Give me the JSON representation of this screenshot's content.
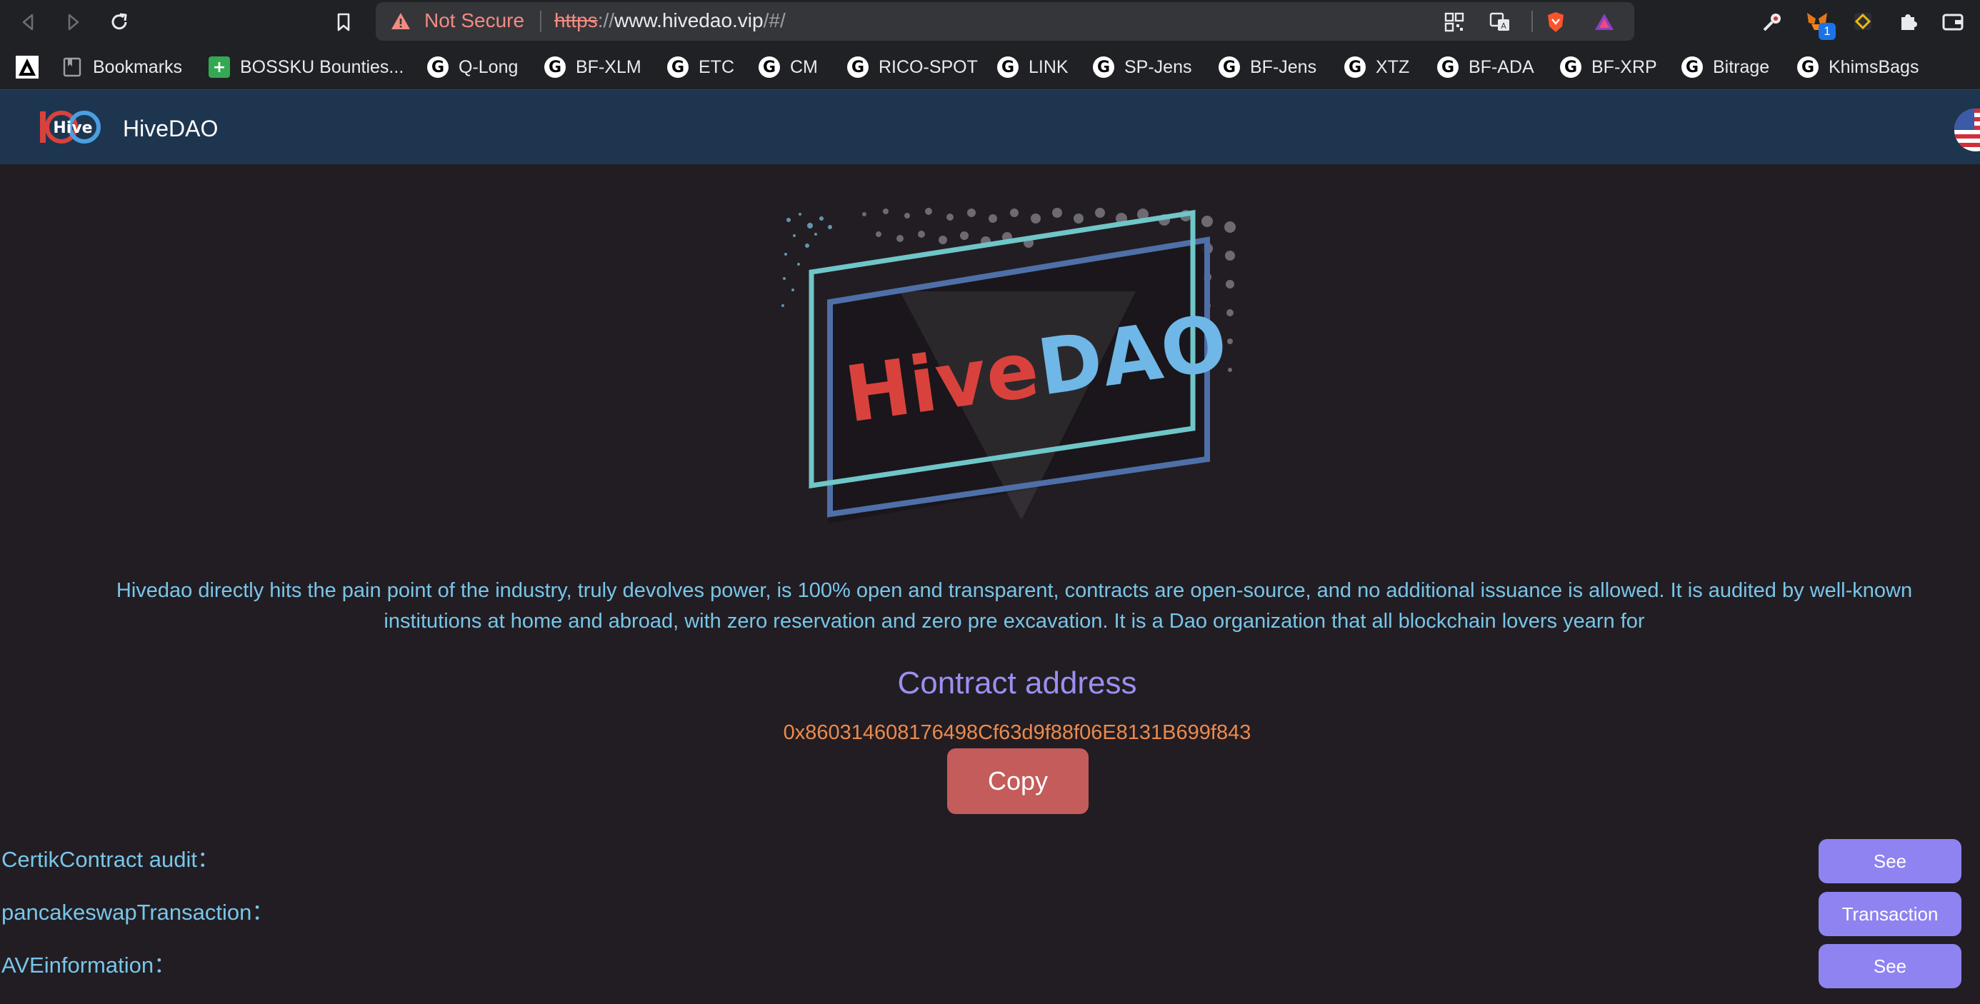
{
  "browser": {
    "security_label": "Not Secure",
    "url_scheme": "https",
    "url_sep": "://",
    "url_host": "www.hivedao.vip",
    "url_tail": "/#/",
    "extension_badge": "1"
  },
  "bookmarks": [
    {
      "label": "Bookmarks"
    },
    {
      "label": "BOSSKU Bounties..."
    },
    {
      "label": "Q-Long"
    },
    {
      "label": "BF-XLM"
    },
    {
      "label": "ETC"
    },
    {
      "label": "CM"
    },
    {
      "label": "RICO-SPOT"
    },
    {
      "label": "LINK"
    },
    {
      "label": "SP-Jens"
    },
    {
      "label": "BF-Jens"
    },
    {
      "label": "XTZ"
    },
    {
      "label": "BF-ADA"
    },
    {
      "label": "BF-XRP"
    },
    {
      "label": "Bitrage"
    },
    {
      "label": "KhimsBags"
    }
  ],
  "site": {
    "brand": "HiveDAO",
    "hero_text_part1": "Hive",
    "hero_text_part2": "DAO",
    "description": "Hivedao directly hits the pain point of the industry, truly devolves power, is 100% open and transparent, contracts are open-source, and no additional issuance is allowed. It is audited by well-known institutions at home and abroad, with zero reservation and zero pre excavation. It is a Dao organization that all blockchain lovers yearn for",
    "contract_title": "Contract address",
    "contract_address": "0x860314608176498Cf63d9f88f06E8131B699f843",
    "copy_label": "Copy",
    "rows": [
      {
        "label": "CertikContract audit：",
        "button": "See"
      },
      {
        "label": "pancakeswapTransaction：",
        "button": "Transaction"
      },
      {
        "label": "AVEinformation：",
        "button": "See"
      }
    ]
  },
  "colors": {
    "page_bg": "#221d22",
    "header_bg": "#1e3550",
    "accent_blue": "#78c6ea",
    "accent_purple": "#9b8ff0",
    "address_orange": "#ec8a4e",
    "copy_button": "#c45c5c",
    "hero_red": "#d9423c",
    "hero_blue": "#6fb7e6"
  }
}
